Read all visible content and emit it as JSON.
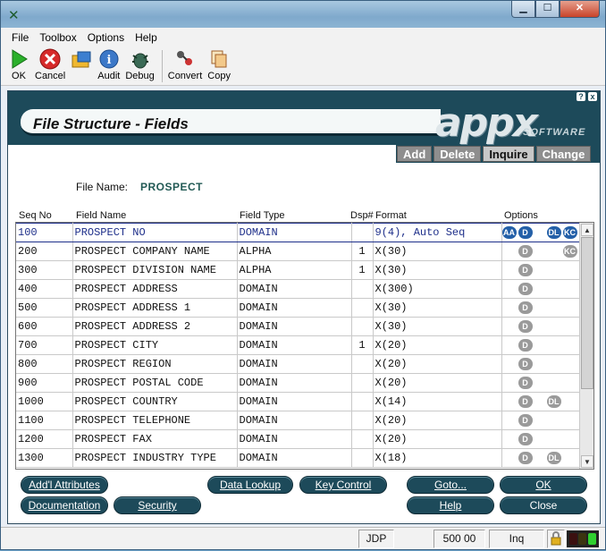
{
  "window": {
    "app_icon": "appx-x-icon",
    "controls": [
      "minimize",
      "maximize",
      "close"
    ]
  },
  "menu": [
    "File",
    "Toolbox",
    "Options",
    "Help"
  ],
  "toolbar": [
    {
      "label": "OK",
      "icon": "green-play-icon"
    },
    {
      "label": "Cancel",
      "icon": "red-x-icon"
    },
    {
      "label": "",
      "icon": "folder-icon"
    },
    {
      "label": "Audit",
      "icon": "info-icon"
    },
    {
      "label": "Debug",
      "icon": "bug-icon"
    },
    {
      "label": "Convert",
      "icon": "convert-icon"
    },
    {
      "label": "Copy",
      "icon": "copy-icon"
    }
  ],
  "screen": {
    "title": "File Structure - Fields",
    "logo": "appx",
    "logo_sub": "SOFTWARE",
    "help_q": "?",
    "help_x": "x"
  },
  "modes": [
    "Add",
    "Delete",
    "Inquire",
    "Change"
  ],
  "active_mode": "Inquire",
  "file": {
    "label": "File Name:",
    "value": "PROSPECT"
  },
  "columns": {
    "seq": "Seq No",
    "name": "Field Name",
    "type": "Field Type",
    "dsp": "Dsp#",
    "format": "Format",
    "options": "Options"
  },
  "rows": [
    {
      "seq": "100",
      "name": "PROSPECT NO",
      "type": "DOMAIN",
      "dsp": "",
      "format": "9(4), Auto Seq",
      "badges": [
        "AA",
        "D",
        "DL",
        "KC"
      ]
    },
    {
      "seq": "200",
      "name": "PROSPECT COMPANY NAME",
      "type": "ALPHA",
      "dsp": "1",
      "format": "X(30)",
      "badges": [
        "D",
        "KC"
      ]
    },
    {
      "seq": "300",
      "name": "PROSPECT DIVISION NAME",
      "type": "ALPHA",
      "dsp": "1",
      "format": "X(30)",
      "badges": [
        "D"
      ]
    },
    {
      "seq": "400",
      "name": "PROSPECT ADDRESS",
      "type": "DOMAIN",
      "dsp": "",
      "format": "X(300)",
      "badges": [
        "D"
      ]
    },
    {
      "seq": "500",
      "name": "PROSPECT ADDRESS 1",
      "type": "DOMAIN",
      "dsp": "",
      "format": "X(30)",
      "badges": [
        "D"
      ]
    },
    {
      "seq": "600",
      "name": "PROSPECT ADDRESS 2",
      "type": "DOMAIN",
      "dsp": "",
      "format": "X(30)",
      "badges": [
        "D"
      ]
    },
    {
      "seq": "700",
      "name": "PROSPECT CITY",
      "type": "DOMAIN",
      "dsp": "1",
      "format": "X(20)",
      "badges": [
        "D"
      ]
    },
    {
      "seq": "800",
      "name": "PROSPECT REGION",
      "type": "DOMAIN",
      "dsp": "",
      "format": "X(20)",
      "badges": [
        "D"
      ]
    },
    {
      "seq": "900",
      "name": "PROSPECT POSTAL CODE",
      "type": "DOMAIN",
      "dsp": "",
      "format": "X(20)",
      "badges": [
        "D"
      ]
    },
    {
      "seq": "1000",
      "name": "PROSPECT COUNTRY",
      "type": "DOMAIN",
      "dsp": "",
      "format": "X(14)",
      "badges": [
        "D",
        "DL"
      ]
    },
    {
      "seq": "1100",
      "name": "PROSPECT TELEPHONE",
      "type": "DOMAIN",
      "dsp": "",
      "format": "X(20)",
      "badges": [
        "D"
      ]
    },
    {
      "seq": "1200",
      "name": "PROSPECT FAX",
      "type": "DOMAIN",
      "dsp": "",
      "format": "X(20)",
      "badges": [
        "D"
      ]
    },
    {
      "seq": "1300",
      "name": "PROSPECT INDUSTRY TYPE",
      "type": "DOMAIN",
      "dsp": "",
      "format": "X(18)",
      "badges": [
        "D",
        "DL"
      ]
    }
  ],
  "buttons": {
    "addl_attributes": "Add'l Attributes",
    "documentation": "Documentation",
    "security": "Security",
    "data_lookup": "Data Lookup",
    "key_control": "Key Control",
    "goto": "Goto...",
    "help": "Help",
    "ok": "OK",
    "close": "Close"
  },
  "status": {
    "user": "JDP",
    "version": "500 00",
    "mode": "Inq"
  },
  "colors": {
    "banner": "#1d4a5a",
    "selected_text": "#1e2f8a",
    "file_value": "#225a55"
  }
}
